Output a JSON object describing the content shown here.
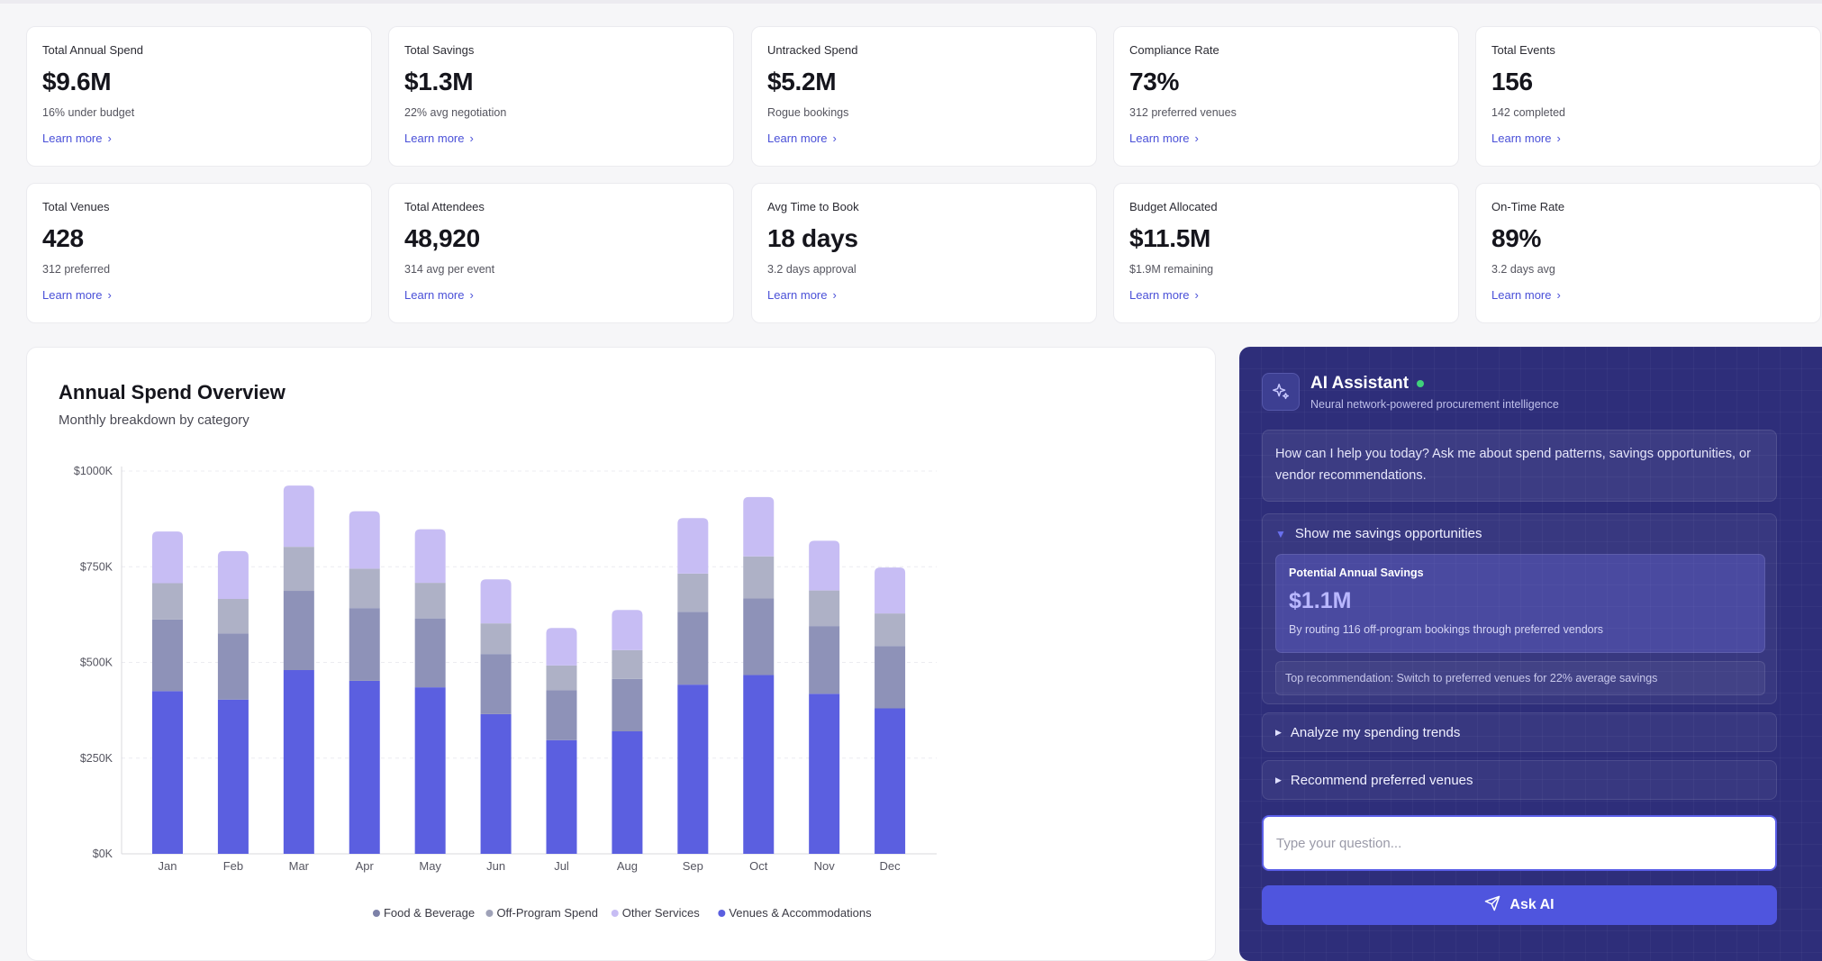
{
  "kpis": [
    {
      "label": "Total Annual Spend",
      "value": "$9.6M",
      "sub": "16% under budget",
      "link": "Learn more"
    },
    {
      "label": "Total Savings",
      "value": "$1.3M",
      "sub": "22% avg negotiation",
      "link": "Learn more"
    },
    {
      "label": "Untracked Spend",
      "value": "$5.2M",
      "sub": "Rogue bookings",
      "link": "Learn more"
    },
    {
      "label": "Compliance Rate",
      "value": "73%",
      "sub": "312 preferred venues",
      "link": "Learn more"
    },
    {
      "label": "Total Events",
      "value": "156",
      "sub": "142 completed",
      "link": "Learn more"
    },
    {
      "label": "Total Venues",
      "value": "428",
      "sub": "312 preferred",
      "link": "Learn more"
    },
    {
      "label": "Total Attendees",
      "value": "48,920",
      "sub": "314 avg per event",
      "link": "Learn more"
    },
    {
      "label": "Avg Time to Book",
      "value": "18 days",
      "sub": "3.2 days approval",
      "link": "Learn more"
    },
    {
      "label": "Budget Allocated",
      "value": "$11.5M",
      "sub": "$1.9M remaining",
      "link": "Learn more"
    },
    {
      "label": "On-Time Rate",
      "value": "89%",
      "sub": "3.2 days avg",
      "link": "Learn more"
    }
  ],
  "chart": {
    "title": "Annual Spend Overview",
    "subtitle": "Monthly breakdown by category"
  },
  "chart_data": {
    "type": "bar",
    "stacked": true,
    "categories": [
      "Jan",
      "Feb",
      "Mar",
      "Apr",
      "May",
      "Jun",
      "Jul",
      "Aug",
      "Sep",
      "Oct",
      "Nov",
      "Dec"
    ],
    "series": [
      {
        "name": "Venues & Accommodations",
        "color": "#5b5fe0",
        "values": [
          425,
          403,
          480,
          452,
          435,
          365,
          297,
          320,
          442,
          467,
          418,
          380
        ]
      },
      {
        "name": "Off-Program Spend",
        "color": "#8e92b8",
        "values": [
          187,
          173,
          207,
          190,
          180,
          157,
          130,
          137,
          190,
          200,
          177,
          163
        ]
      },
      {
        "name": "Food & Beverage",
        "color": "#aeb1c6",
        "values": [
          95,
          90,
          115,
          103,
          93,
          80,
          65,
          75,
          100,
          110,
          93,
          85
        ]
      },
      {
        "name": "Other Services",
        "color": "#c7bdf4",
        "values": [
          135,
          125,
          160,
          150,
          140,
          115,
          98,
          105,
          145,
          155,
          130,
          120
        ]
      }
    ],
    "legend_order": [
      "Food & Beverage",
      "Off-Program Spend",
      "Other Services",
      "Venues & Accommodations"
    ],
    "legend_colors": [
      "#7d81a8",
      "#9fa2b8",
      "#c7bdf4",
      "#5b5fe0"
    ],
    "yticks": [
      "$0K",
      "$250K",
      "$500K",
      "$750K",
      "$1000K"
    ],
    "ylim": [
      0,
      1000
    ],
    "grid": true,
    "legend_position": "bottom-center"
  },
  "ai": {
    "title": "AI Assistant",
    "subtitle": "Neural network-powered procurement intelligence",
    "greeting": "How can I help you today? Ask me about spend patterns, savings opportunities, or vendor recommendations.",
    "expanded_label": "Show me savings opportunities",
    "savings_label": "Potential Annual Savings",
    "savings_value": "$1.1M",
    "savings_desc": "By routing 116 off-program bookings through preferred vendors",
    "recommendation": "Top recommendation: Switch to preferred venues for 22% average savings",
    "row1": "Analyze my spending trends",
    "row2": "Recommend preferred venues",
    "input_placeholder": "Type your question...",
    "button_label": "Ask AI",
    "status_color": "#3fd17b"
  }
}
